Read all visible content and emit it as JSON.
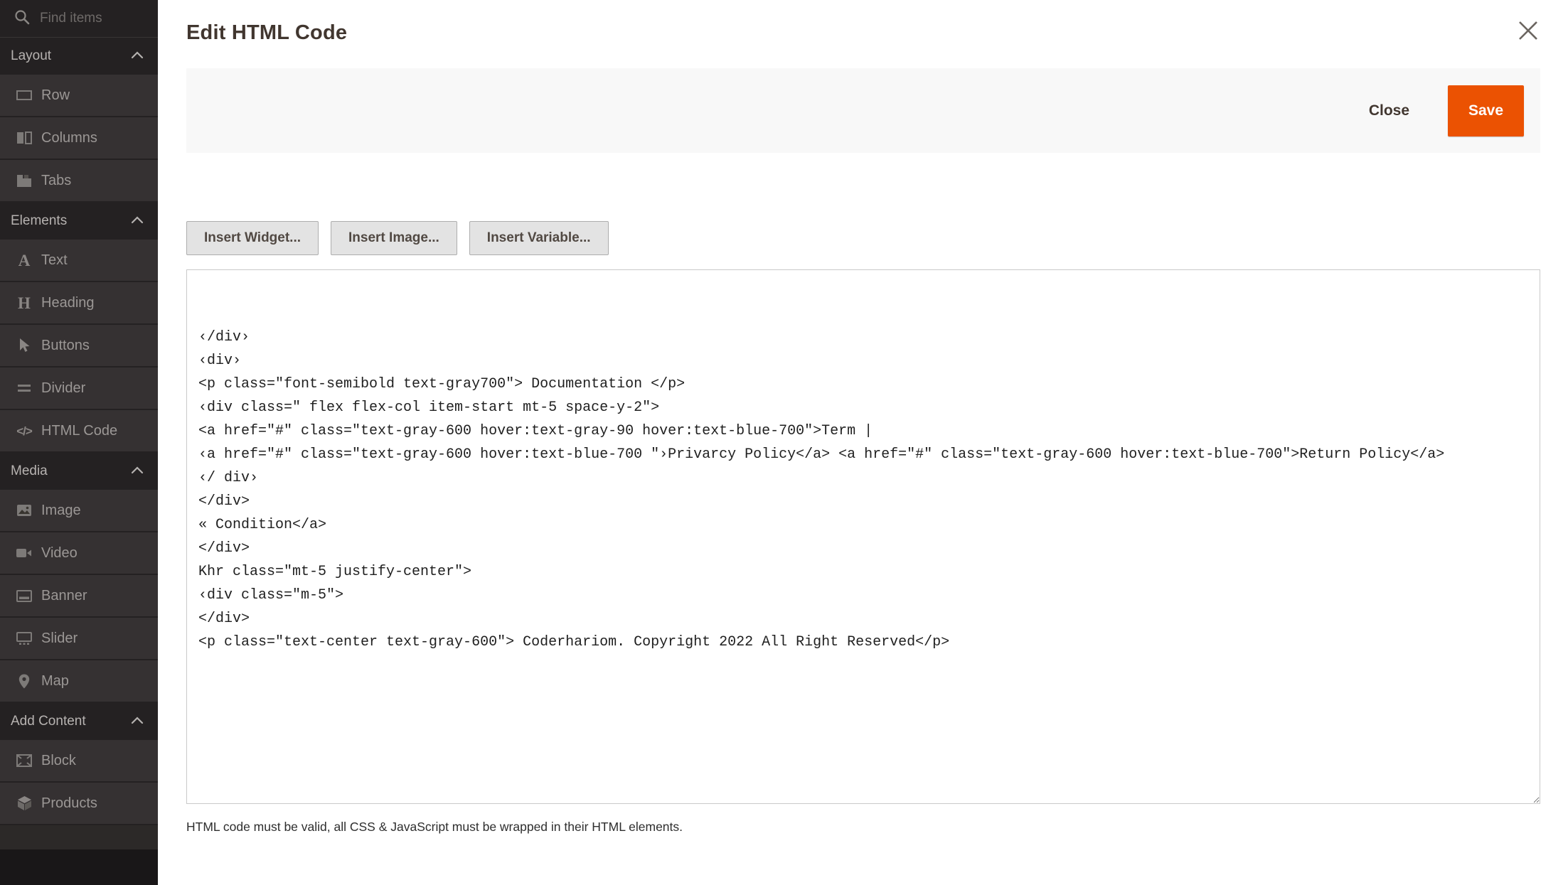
{
  "sidebar": {
    "search": {
      "placeholder": "Find items",
      "icon": "search-icon"
    },
    "sections": [
      {
        "label": "Layout",
        "collapse_icon": "chevron-up-icon",
        "items": [
          {
            "label": "Row",
            "icon": "row-icon"
          },
          {
            "label": "Columns",
            "icon": "columns-icon"
          },
          {
            "label": "Tabs",
            "icon": "tabs-icon"
          }
        ]
      },
      {
        "label": "Elements",
        "collapse_icon": "chevron-up-icon",
        "items": [
          {
            "label": "Text",
            "icon": "text-icon"
          },
          {
            "label": "Heading",
            "icon": "heading-icon"
          },
          {
            "label": "Buttons",
            "icon": "cursor-icon"
          },
          {
            "label": "Divider",
            "icon": "divider-icon"
          },
          {
            "label": "HTML Code",
            "icon": "code-icon"
          }
        ]
      },
      {
        "label": "Media",
        "collapse_icon": "chevron-up-icon",
        "items": [
          {
            "label": "Image",
            "icon": "image-icon"
          },
          {
            "label": "Video",
            "icon": "video-icon"
          },
          {
            "label": "Banner",
            "icon": "banner-icon"
          },
          {
            "label": "Slider",
            "icon": "slider-icon"
          },
          {
            "label": "Map",
            "icon": "map-pin-icon"
          }
        ]
      },
      {
        "label": "Add Content",
        "collapse_icon": "chevron-up-icon",
        "items": [
          {
            "label": "Block",
            "icon": "block-icon"
          },
          {
            "label": "Products",
            "icon": "products-icon"
          }
        ]
      }
    ],
    "icon_glyphs": {
      "text": "A",
      "heading": "H",
      "code": "</>"
    }
  },
  "modal": {
    "title": "Edit HTML Code",
    "close_icon": "close-icon",
    "toolbar": {
      "close_label": "Close",
      "save_label": "Save",
      "save_color": "#eb5202"
    },
    "insert_buttons": [
      "Insert Widget...",
      "Insert Image...",
      "Insert Variable..."
    ],
    "code_lines": [
      "",
      "",
      "‹/div›",
      "‹div›",
      "<p class=\"font-semibold text-gray700\"> Documentation </p>",
      "‹div class=\" flex flex-col item-start mt-5 space-y-2\">",
      "<a href=\"#\" class=\"text-gray-600 hover:text-gray-90 hover:text-blue-700\">Term |",
      "‹a href=\"#\" class=\"text-gray-600 hover:text-blue-700 \"›Privarcy Policy</a> <a href=\"#\" class=\"text-gray-600 hover:text-blue-700\">Return Policy</a>",
      "‹/ div›",
      "</div>",
      "« Condition</a>",
      "</div>",
      "Khr class=\"mt-5 justify-center\">",
      "‹div class=\"m-5\">",
      "</div>",
      "<p class=\"text-center text-gray-600\"> Coderhariom. Copyright 2022 All Right Reserved</p>"
    ],
    "note": "HTML code must be valid, all CSS & JavaScript must be wrapped in their HTML elements."
  }
}
